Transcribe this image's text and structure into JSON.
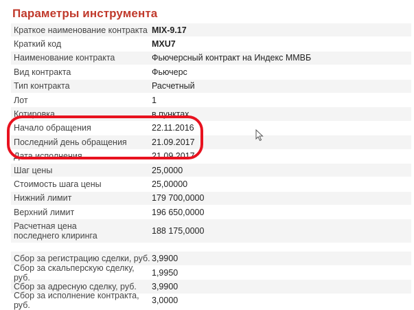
{
  "title": "Параметры инструмента",
  "rows_top": [
    {
      "label": "Краткое наименование контракта",
      "value": "MIX-9.17",
      "bold": true
    },
    {
      "label": "Краткий код",
      "value": "MXU7",
      "bold": true
    },
    {
      "label": "Наименование контракта",
      "value": "Фьючерсный контракт на Индекс ММВБ"
    },
    {
      "label": "Вид контракта",
      "value": "Фьючерс"
    },
    {
      "label": "Тип контракта",
      "value": "Расчетный"
    },
    {
      "label": "Лот",
      "value": "1"
    },
    {
      "label": "Котировка",
      "value": "в пунктах"
    },
    {
      "label": "Начало обращения",
      "value": "22.11.2016"
    },
    {
      "label": "Последний день обращения",
      "value": "21.09.2017"
    },
    {
      "label": "Дата исполнения",
      "value": "21.09.2017"
    },
    {
      "label": "Шаг цены",
      "value": "25,0000"
    },
    {
      "label": "Стоимость шага цены",
      "value": "25,00000"
    },
    {
      "label": "Нижний лимит",
      "value": "179 700,0000"
    },
    {
      "label": "Верхний лимит",
      "value": "196 650,0000"
    },
    {
      "label": "Расчетная цена\nпоследнего клиринга",
      "value": "188 175,0000"
    }
  ],
  "rows_fees": [
    {
      "label": "Сбор за регистрацию сделки, руб.",
      "value": "3,9900"
    },
    {
      "label": "Сбор за скальперскую сделку, руб.",
      "value": "1,9950"
    },
    {
      "label": "Сбор за адресную сделку, руб.",
      "value": "3,9900"
    },
    {
      "label": "Сбор за исполнение контракта, руб.",
      "value": "3,0000"
    }
  ],
  "colors": {
    "title": "#c0392b",
    "highlight": "#e8121f",
    "stripe": "#f4f4f4"
  }
}
